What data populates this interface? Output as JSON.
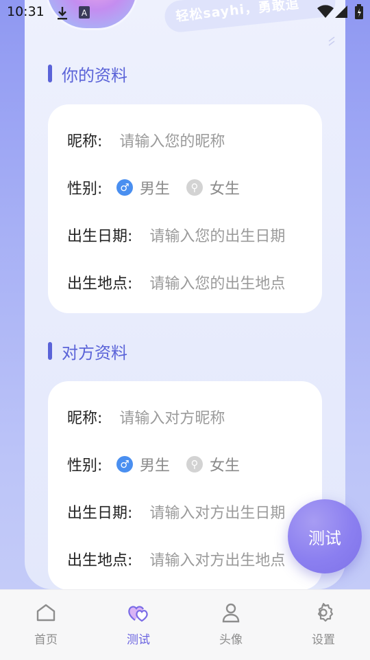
{
  "status_bar": {
    "time": "10:31"
  },
  "banner": {
    "tag_text": "轻松sayhi，勇敢追"
  },
  "my_profile": {
    "title": "你的资料",
    "nickname_label": "昵称:",
    "nickname_placeholder": "请输入您的昵称",
    "gender_label": "性别:",
    "gender_male": "男生",
    "gender_female": "女生",
    "gender_selected": "male",
    "birthdate_label": "出生日期:",
    "birthdate_placeholder": "请输入您的出生日期",
    "birthplace_label": "出生地点:",
    "birthplace_placeholder": "请输入您的出生地点"
  },
  "partner_profile": {
    "title": "对方资料",
    "nickname_label": "昵称:",
    "nickname_placeholder": "请输入对方昵称",
    "gender_label": "性别:",
    "gender_male": "男生",
    "gender_female": "女生",
    "gender_selected": "male",
    "birthdate_label": "出生日期:",
    "birthdate_placeholder": "请输入对方出生日期",
    "birthplace_label": "出生地点:",
    "birthplace_placeholder": "请输入对方出生地点"
  },
  "fab": {
    "label": "测试"
  },
  "nav": {
    "items": [
      {
        "label": "首页",
        "icon": "home-icon",
        "active": false
      },
      {
        "label": "测试",
        "icon": "hearts-icon",
        "active": true
      },
      {
        "label": "头像",
        "icon": "person-icon",
        "active": false
      },
      {
        "label": "设置",
        "icon": "gear-icon",
        "active": false
      }
    ]
  },
  "colors": {
    "accent": "#5a63d8",
    "active_nav": "#6a63e0",
    "male": "#4a8ff0"
  }
}
